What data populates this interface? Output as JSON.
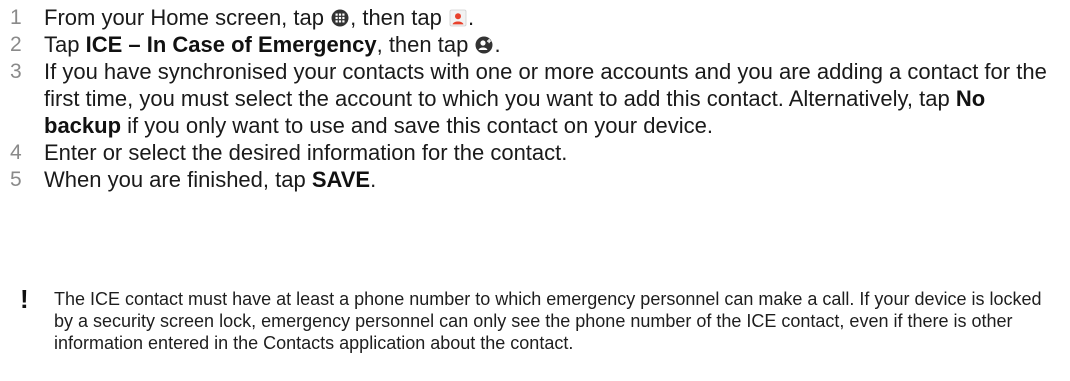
{
  "steps": [
    {
      "number": "1",
      "t1": "From your Home screen, tap ",
      "icon1": "apps-grid-icon",
      "t2": ", then tap ",
      "icon2": "contacts-app-icon",
      "t3": "."
    },
    {
      "number": "2",
      "t1": "Tap ",
      "bold": "ICE – In Case of Emergency",
      "t2": ", then tap ",
      "icon": "add-contact-icon",
      "t3": "."
    },
    {
      "number": "3",
      "t1": "If you have synchronised your contacts with one or more accounts and you are adding a contact for the first time, you must select the account to which you want to add this contact. Alternatively, tap ",
      "bold": "No backup",
      "t2": " if you only want to use and save this contact on your device."
    },
    {
      "number": "4",
      "text": "Enter or select the desired information for the contact."
    },
    {
      "number": "5",
      "t1": "When you are finished, tap ",
      "bold": "SAVE",
      "t2": "."
    }
  ],
  "note": {
    "icon": "exclamation-icon",
    "text": "The ICE contact must have at least a phone number to which emergency personnel can make a call. If your device is locked by a security screen lock, emergency personnel can only see the phone number of the ICE contact, even if there is other information entered in the Contacts application about the contact."
  },
  "colors": {
    "step_number": "#8a8a8a",
    "text": "#1a1a1a",
    "contacts_icon_accent": "#e8412c"
  }
}
